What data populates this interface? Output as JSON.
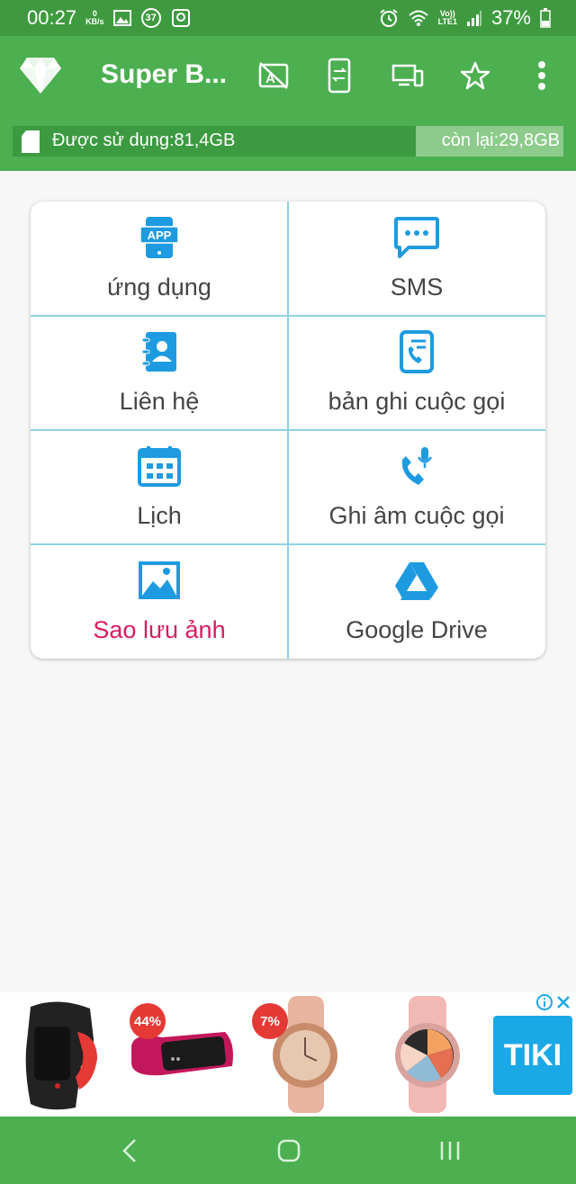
{
  "status": {
    "time": "00:27",
    "net_speed": "0",
    "net_unit": "KB/s",
    "notif_count": "37",
    "network": "Vo))",
    "network_sub": "LTE1",
    "battery": "37%"
  },
  "appbar": {
    "title": "Super B..."
  },
  "storage": {
    "used_label": "Được sử dụng:81,4GB",
    "free_label": "còn lại:29,8GB",
    "free_fraction": 0.268
  },
  "grid": {
    "items": [
      {
        "label": "ứng dụng",
        "icon": "app-icon"
      },
      {
        "label": "SMS",
        "icon": "sms-icon"
      },
      {
        "label": "Liên hệ",
        "icon": "contacts-icon"
      },
      {
        "label": "bản ghi cuộc gọi",
        "icon": "call-log-icon"
      },
      {
        "label": "Lịch",
        "icon": "calendar-icon"
      },
      {
        "label": "Ghi âm cuộc gọi",
        "icon": "call-recorder-icon"
      },
      {
        "label": "Sao lưu ảnh",
        "icon": "photo-icon"
      },
      {
        "label": "Google Drive",
        "icon": "google-drive-icon"
      }
    ]
  },
  "ads": {
    "badges": [
      "44%",
      "7%"
    ],
    "brand": "TIKI"
  },
  "colors": {
    "status_bar": "#3f9a3f",
    "app_bar": "#4caf50",
    "icon_blue": "#1e9be0",
    "divider": "#8fd0e6",
    "accent_label": "#d81b60"
  }
}
